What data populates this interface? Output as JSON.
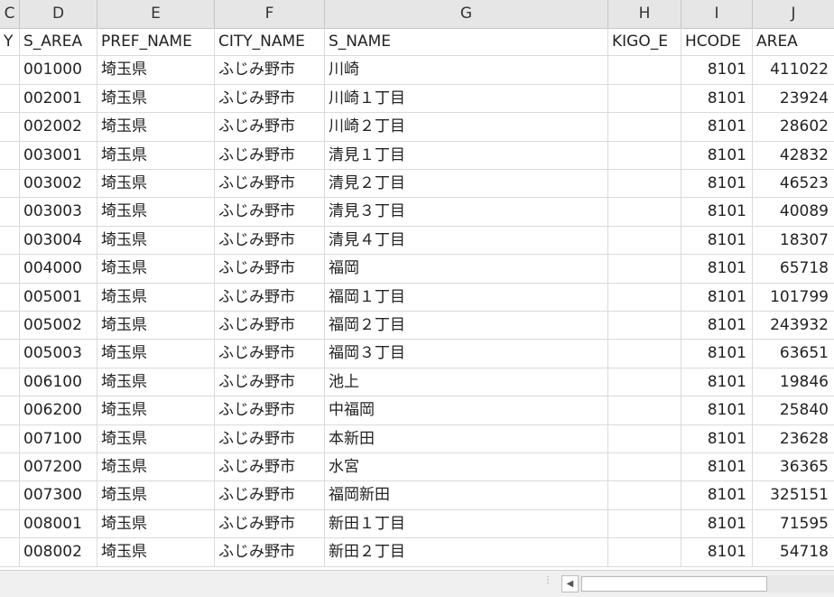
{
  "columns": {
    "c": "C",
    "d": "D",
    "e": "E",
    "f": "F",
    "g": "G",
    "h": "H",
    "i": "I",
    "j": "J"
  },
  "header_row": {
    "c": "Y",
    "d": "S_AREA",
    "e": "PREF_NAME",
    "f": "CITY_NAME",
    "g": "S_NAME",
    "h": "KIGO_E",
    "i": "HCODE",
    "j": "AREA"
  },
  "rows": [
    {
      "c": "",
      "d": "001000",
      "e": "埼玉県",
      "f": "ふじみ野市",
      "g": "川崎",
      "h": "",
      "i": "8101",
      "j": "411022"
    },
    {
      "c": "",
      "d": "002001",
      "e": "埼玉県",
      "f": "ふじみ野市",
      "g": "川崎１丁目",
      "h": "",
      "i": "8101",
      "j": "23924"
    },
    {
      "c": "",
      "d": "002002",
      "e": "埼玉県",
      "f": "ふじみ野市",
      "g": "川崎２丁目",
      "h": "",
      "i": "8101",
      "j": "28602"
    },
    {
      "c": "",
      "d": "003001",
      "e": "埼玉県",
      "f": "ふじみ野市",
      "g": "清見１丁目",
      "h": "",
      "i": "8101",
      "j": "42832"
    },
    {
      "c": "",
      "d": "003002",
      "e": "埼玉県",
      "f": "ふじみ野市",
      "g": "清見２丁目",
      "h": "",
      "i": "8101",
      "j": "46523"
    },
    {
      "c": "",
      "d": "003003",
      "e": "埼玉県",
      "f": "ふじみ野市",
      "g": "清見３丁目",
      "h": "",
      "i": "8101",
      "j": "40089"
    },
    {
      "c": "",
      "d": "003004",
      "e": "埼玉県",
      "f": "ふじみ野市",
      "g": "清見４丁目",
      "h": "",
      "i": "8101",
      "j": "18307"
    },
    {
      "c": "",
      "d": "004000",
      "e": "埼玉県",
      "f": "ふじみ野市",
      "g": "福岡",
      "h": "",
      "i": "8101",
      "j": "65718"
    },
    {
      "c": "",
      "d": "005001",
      "e": "埼玉県",
      "f": "ふじみ野市",
      "g": "福岡１丁目",
      "h": "",
      "i": "8101",
      "j": "101799"
    },
    {
      "c": "",
      "d": "005002",
      "e": "埼玉県",
      "f": "ふじみ野市",
      "g": "福岡２丁目",
      "h": "",
      "i": "8101",
      "j": "243932"
    },
    {
      "c": "",
      "d": "005003",
      "e": "埼玉県",
      "f": "ふじみ野市",
      "g": "福岡３丁目",
      "h": "",
      "i": "8101",
      "j": "63651"
    },
    {
      "c": "",
      "d": "006100",
      "e": "埼玉県",
      "f": "ふじみ野市",
      "g": "池上",
      "h": "",
      "i": "8101",
      "j": "19846"
    },
    {
      "c": "",
      "d": "006200",
      "e": "埼玉県",
      "f": "ふじみ野市",
      "g": "中福岡",
      "h": "",
      "i": "8101",
      "j": "25840"
    },
    {
      "c": "",
      "d": "007100",
      "e": "埼玉県",
      "f": "ふじみ野市",
      "g": "本新田",
      "h": "",
      "i": "8101",
      "j": "23628"
    },
    {
      "c": "",
      "d": "007200",
      "e": "埼玉県",
      "f": "ふじみ野市",
      "g": "水宮",
      "h": "",
      "i": "8101",
      "j": "36365"
    },
    {
      "c": "",
      "d": "007300",
      "e": "埼玉県",
      "f": "ふじみ野市",
      "g": "福岡新田",
      "h": "",
      "i": "8101",
      "j": "325151"
    },
    {
      "c": "",
      "d": "008001",
      "e": "埼玉県",
      "f": "ふじみ野市",
      "g": "新田１丁目",
      "h": "",
      "i": "8101",
      "j": "71595"
    },
    {
      "c": "",
      "d": "008002",
      "e": "埼玉県",
      "f": "ふじみ野市",
      "g": "新田２丁目",
      "h": "",
      "i": "8101",
      "j": "54718"
    }
  ],
  "scroll_left_icon": "scroll-left-arrow-icon",
  "colors": {
    "header_bg": "#e6e6e6",
    "gridline": "#dadada"
  }
}
